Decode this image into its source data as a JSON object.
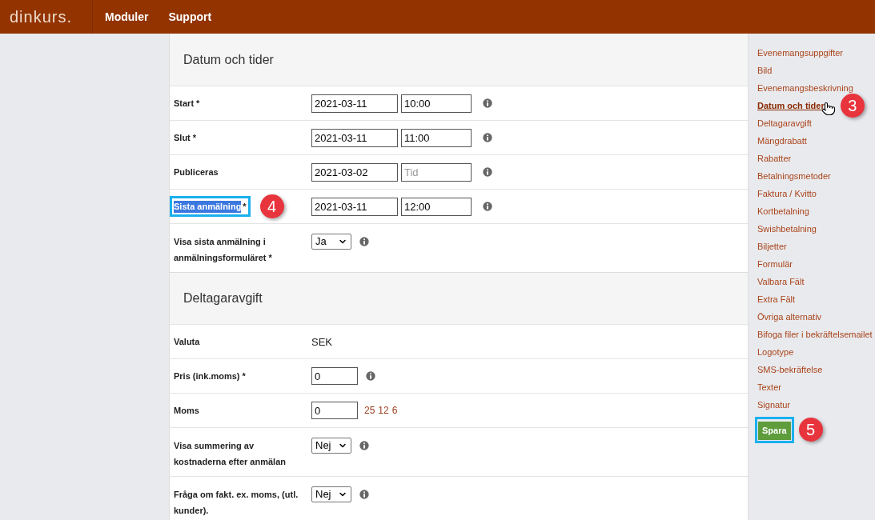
{
  "header": {
    "logo": "dinkurs.",
    "nav": [
      "Moduler",
      "Support"
    ]
  },
  "sections": [
    {
      "title": "Datum och tider",
      "rows": [
        {
          "kind": "datetime",
          "label": "Start *",
          "date": "2021-03-11",
          "time": "10:00",
          "info": true
        },
        {
          "kind": "datetime",
          "label": "Slut *",
          "date": "2021-03-11",
          "time": "11:00",
          "info": true
        },
        {
          "kind": "datetime",
          "label": "Publiceras",
          "date": "2021-03-02",
          "time_placeholder": "Tid",
          "info": true
        },
        {
          "kind": "datetime",
          "label": "Sista anmälning",
          "label_suffix": "*",
          "highlighted": true,
          "callout": "4",
          "date": "2021-03-11",
          "time": "12:00",
          "info": true
        },
        {
          "kind": "select",
          "label": "Visa sista anmälning i anmälningsformuläret *",
          "value": "Ja",
          "info": true
        }
      ]
    },
    {
      "title": "Deltagaravgift",
      "rows": [
        {
          "kind": "text",
          "label": "Valuta",
          "value": "SEK"
        },
        {
          "kind": "number",
          "label": "Pris (ink.moms) *",
          "value": "0",
          "info": true
        },
        {
          "kind": "number",
          "label": "Moms",
          "value": "0",
          "presets": [
            "25",
            "12",
            "6"
          ]
        },
        {
          "kind": "select",
          "label": "Visa summering av kostnaderna efter anmälan",
          "value": "Nej",
          "info": true
        },
        {
          "kind": "select",
          "label": "Fråga om fakt. ex. moms, (utl. kunder).",
          "value": "Nej",
          "info": true
        }
      ]
    }
  ],
  "sidebar": {
    "items": [
      {
        "label": "Evenemangsuppgifter",
        "selected": false
      },
      {
        "label": "Bild",
        "selected": false
      },
      {
        "label": "Evenemangsbeskrivning",
        "selected": false
      },
      {
        "label": "Datum och tider",
        "selected": true,
        "callout": "3"
      },
      {
        "label": "Deltagaravgift",
        "selected": false
      },
      {
        "label": "Mängdrabatt",
        "selected": false
      },
      {
        "label": "Rabatter",
        "selected": false
      },
      {
        "label": "Betalningsmetoder",
        "selected": false
      },
      {
        "label": "Faktura / Kvitto",
        "selected": false
      },
      {
        "label": "Kortbetalning",
        "selected": false
      },
      {
        "label": "Swishbetalning",
        "selected": false
      },
      {
        "label": "Biljetter",
        "selected": false
      },
      {
        "label": "Formulär",
        "selected": false
      },
      {
        "label": "Valbara Fält",
        "selected": false
      },
      {
        "label": "Extra Fält",
        "selected": false
      },
      {
        "label": "Övriga alternativ",
        "selected": false
      },
      {
        "label": "Bifoga filer i bekräftelsemailet",
        "selected": false
      },
      {
        "label": "Logotype",
        "selected": false
      },
      {
        "label": "SMS-bekräftelse",
        "selected": false
      },
      {
        "label": "Texter",
        "selected": false
      },
      {
        "label": "Signatur",
        "selected": false
      }
    ],
    "save": {
      "label": "Spara",
      "highlighted": true,
      "callout": "5"
    }
  }
}
